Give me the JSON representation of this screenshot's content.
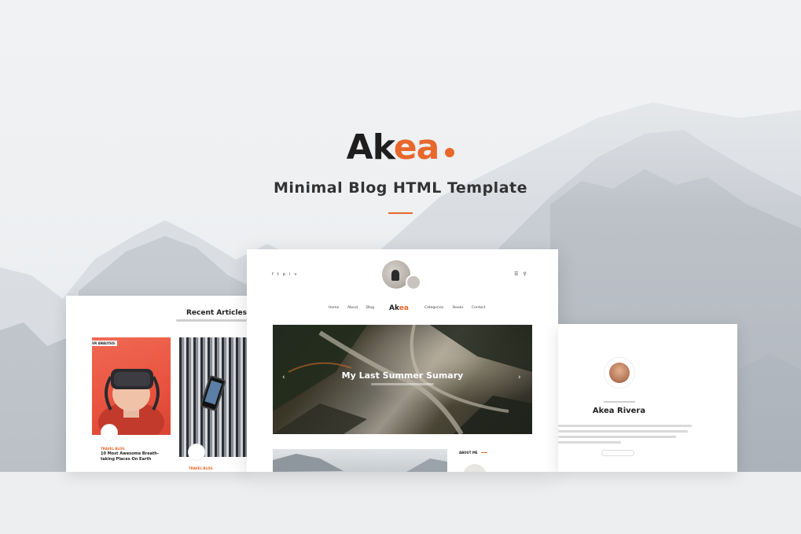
{
  "brand": {
    "prefix": "Ak",
    "accent": "ea",
    "accent_color": "#e8672b"
  },
  "tagline": "Minimal Blog HTML Template",
  "left_card": {
    "heading": "Recent Articles",
    "badge": "VR ANALYSIS",
    "posts": [
      {
        "category": "TRAVEL BLOG",
        "title": "10 Most Awesome Breath- taking Places On Earth"
      },
      {
        "category": "TRAVEL BLOG"
      }
    ]
  },
  "center_card": {
    "social_icons": [
      "f",
      "t",
      "p",
      "i",
      "v"
    ],
    "header_icons": [
      "menu-icon",
      "search-icon"
    ],
    "nav": {
      "left": [
        "Home",
        "About",
        "Blog"
      ],
      "logo_prefix": "Ak",
      "logo_accent": "ea",
      "right": [
        "Categories",
        "Books",
        "Contact"
      ]
    },
    "slider": {
      "title": "My Last Summer Sumary",
      "prev": "‹",
      "next": "›"
    },
    "about_label": "ABOUT ME"
  },
  "right_card": {
    "name": "Akea Rivera"
  }
}
